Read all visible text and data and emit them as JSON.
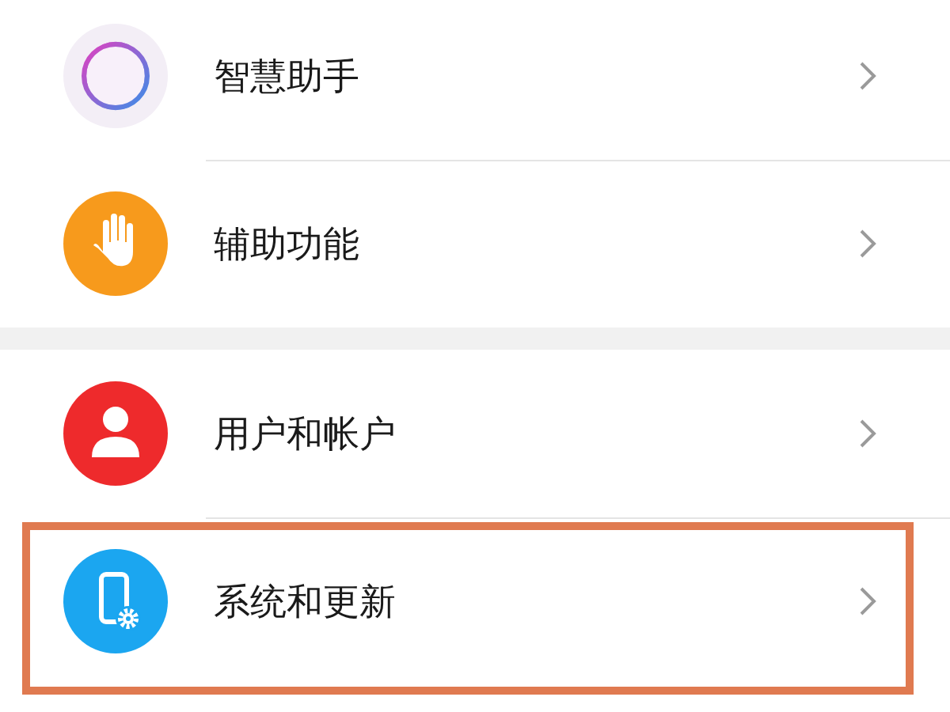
{
  "groups": [
    {
      "items": [
        {
          "label": "智慧助手",
          "kind": "assistant",
          "highlighted": false
        },
        {
          "label": "辅助功能",
          "kind": "hand",
          "highlighted": false
        }
      ]
    },
    {
      "items": [
        {
          "label": "用户和帐户",
          "kind": "user",
          "highlighted": false
        },
        {
          "label": "系统和更新",
          "kind": "phone-settings",
          "highlighted": true
        }
      ]
    }
  ]
}
